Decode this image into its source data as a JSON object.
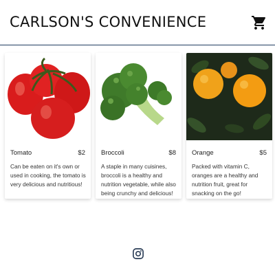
{
  "header": {
    "title": "CARLSON'S CONVENIENCE",
    "cart_icon": "shopping-cart-icon"
  },
  "products": [
    {
      "name": "Tomato",
      "price": "$2",
      "description": "Can be eaten on it's own or used in cooking, the tomato is very delicious and nutritious!",
      "image": "tomato-photo"
    },
    {
      "name": "Broccoli",
      "price": "$8",
      "description": "A staple in many cuisines, broccoli is a healthy and nutrition vegetable, while also being crunchy and delicious!",
      "image": "broccoli-photo"
    },
    {
      "name": "Orange",
      "price": "$5",
      "description": "Packed with vitamin C, oranges are a healthy and nutrition fruit, great for snacking on the go!",
      "image": "orange-photo"
    }
  ],
  "footer": {
    "social_icon": "instagram-icon"
  },
  "colors": {
    "header_rule": "#1f3a5f",
    "background": "#ffffff"
  }
}
